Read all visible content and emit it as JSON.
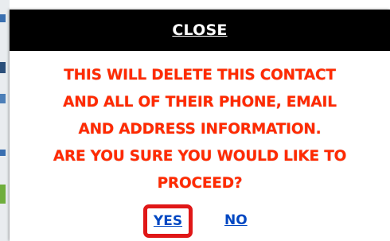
{
  "dialog": {
    "close_label": "CLOSE",
    "message_lines": [
      "THIS WILL DELETE THIS CONTACT",
      "AND ALL OF THEIR PHONE, EMAIL",
      "AND ADDRESS INFORMATION.",
      "ARE YOU SURE YOU WOULD LIKE TO",
      "PROCEED?"
    ],
    "yes_label": "YES",
    "no_label": "NO"
  },
  "colors": {
    "close_bar": "#000000",
    "message_text": "#ff2a00",
    "link": "#0047c2",
    "highlight": "#e01717"
  }
}
